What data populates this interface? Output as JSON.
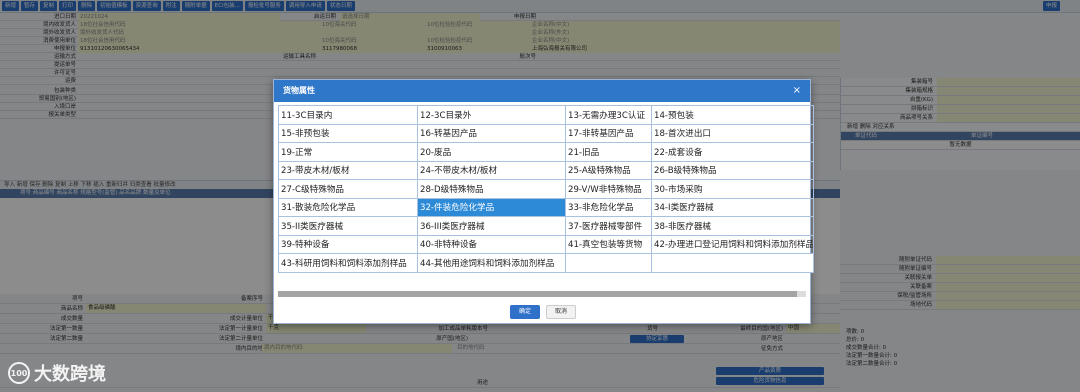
{
  "toolbar": {
    "buttons": [
      "新增",
      "暂存",
      "复制",
      "打印",
      "删除",
      "初始值模板",
      "资源查询",
      "附注",
      "随附单据",
      "ECI包装...",
      "报检批号服务",
      "调用导入申请",
      "状态日期"
    ],
    "right_button": "申报"
  },
  "form": {
    "rows": [
      {
        "label": "进口日期",
        "value": "20221024",
        "mid_label": "启运日期",
        "mid_value": "请选择日期",
        "right_label": "申报日期"
      },
      {
        "label": "境内收发货人",
        "value": "18位社会信用代码",
        "v2": "10位海关代码",
        "v3": "10位检验检疫代码",
        "v4": "企业名称(中文)"
      },
      {
        "label": "境外收发货人",
        "value": "境外收发货人代码",
        "v4": "企业名称(外文)"
      },
      {
        "label": "消费使用单位",
        "value": "18位社会信用代码",
        "v2": "10位海关代码",
        "v3": "10位检验检疫代码",
        "v4": "企业名称(中文)"
      },
      {
        "label": "申报单位",
        "value": "91310120630065434",
        "v2": "3117980068",
        "v3": "3100910063",
        "v4": "上海弘海报关有限公司"
      },
      {
        "label": "运输方式",
        "mid_label": "运输工具名称",
        "right_label": "航次号"
      },
      {
        "label": "提运单号"
      },
      {
        "label": "许可证号"
      },
      {
        "label": "运费"
      },
      {
        "label": "包装种类"
      },
      {
        "label": "贸易国别(地区)"
      },
      {
        "label": "入境口岸"
      },
      {
        "label": "报关单类型"
      }
    ]
  },
  "right_panel": {
    "rows": [
      "集装箱号",
      "集装箱规格",
      "自重(KG)",
      "拼箱标识",
      "商品项号关系"
    ],
    "grid_header": "单证编号",
    "grid_col": "单证代码",
    "grid_empty": "暂无数据",
    "grid_toolbar": "新增 删除 对应关系"
  },
  "goods_grid": {
    "toolbar": "导入 新增 保存 删除 复制 上移 下移 插入 重新归并 归类查看 批量修改",
    "header": "项号  商品编号  商品名称  规格型号(监管)  品名品牌  数量及单位"
  },
  "bottom_form": {
    "rows": [
      {
        "l1": "项号",
        "l2": "备案序号"
      },
      {
        "l1": "商品名称",
        "v1": "食品级磷酸"
      },
      {
        "l1": "成交数量",
        "l2": "成交计量单位",
        "v2": "千克"
      },
      {
        "l1": "法定第一数量",
        "l2": "法定第一计量单位",
        "v2": "千克",
        "l3": "加工成品单耗版本号",
        "l4": "货号",
        "l5": "最终目的国(地区)",
        "v5": "中国"
      },
      {
        "l1": "法定第二数量",
        "l2": "法定第二计量单位",
        "l4": "原产国(地区)",
        "btn": "协定享惠",
        "l5": "原产地区"
      },
      {
        "l1": "",
        "l2": "境内目的地",
        "v2": "境内目的地代码",
        "v3": "目的地代码",
        "l5": "征免方式"
      },
      {
        "l4": "用途"
      }
    ]
  },
  "right_bottom": {
    "rows": [
      "随附单证代码",
      "随附单证编号",
      "",
      "关联报关单",
      "关联备案",
      "保税/监管场所",
      "场地代码"
    ],
    "stats": [
      "项数: 0",
      "总价: 0",
      "成交数量合计: 0",
      "法定第一数量合计: 0",
      "法定第二数量合计: 0"
    ],
    "buttons": [
      "产品资质",
      "危险货物信息"
    ]
  },
  "logo": {
    "mark": "100",
    "text": "大数跨境"
  },
  "modal": {
    "title": "货物属性",
    "close": "×",
    "options": [
      [
        "11-3C目录内",
        "12-3C目录外",
        "13-无需办理3C认证",
        "14-预包装"
      ],
      [
        "15-非预包装",
        "16-转基因产品",
        "17-非转基因产品",
        "18-首次进出口"
      ],
      [
        "19-正常",
        "20-废品",
        "21-旧品",
        "22-成套设备"
      ],
      [
        "23-带皮木材/板材",
        "24-不带皮木材/板材",
        "25-A级特殊物品",
        "26-B级特殊物品"
      ],
      [
        "27-C级特殊物品",
        "28-D级特殊物品",
        "29-V/W非特殊物品",
        "30-市场采购"
      ],
      [
        "31-散装危险化学品",
        "32-件装危险化学品",
        "33-非危险化学品",
        "34-I类医疗器械"
      ],
      [
        "35-II类医疗器械",
        "36-III类医疗器械",
        "37-医疗器械零部件",
        "38-非医疗器械"
      ],
      [
        "39-特种设备",
        "40-非特种设备",
        "41-真空包装等货物",
        "42-办理进口登记用饲料和饲料添加剂样品"
      ],
      [
        "43-科研用饲料和饲料添加剂样品",
        "44-其他用途饲料和饲料添加剂样品",
        "",
        ""
      ]
    ],
    "selected": "32-件装危险化学品",
    "ok": "确定",
    "cancel": "取消"
  },
  "colors": {
    "accent": "#2f77c9",
    "selected": "#2d8ad6",
    "field": "#f3f6cf"
  }
}
